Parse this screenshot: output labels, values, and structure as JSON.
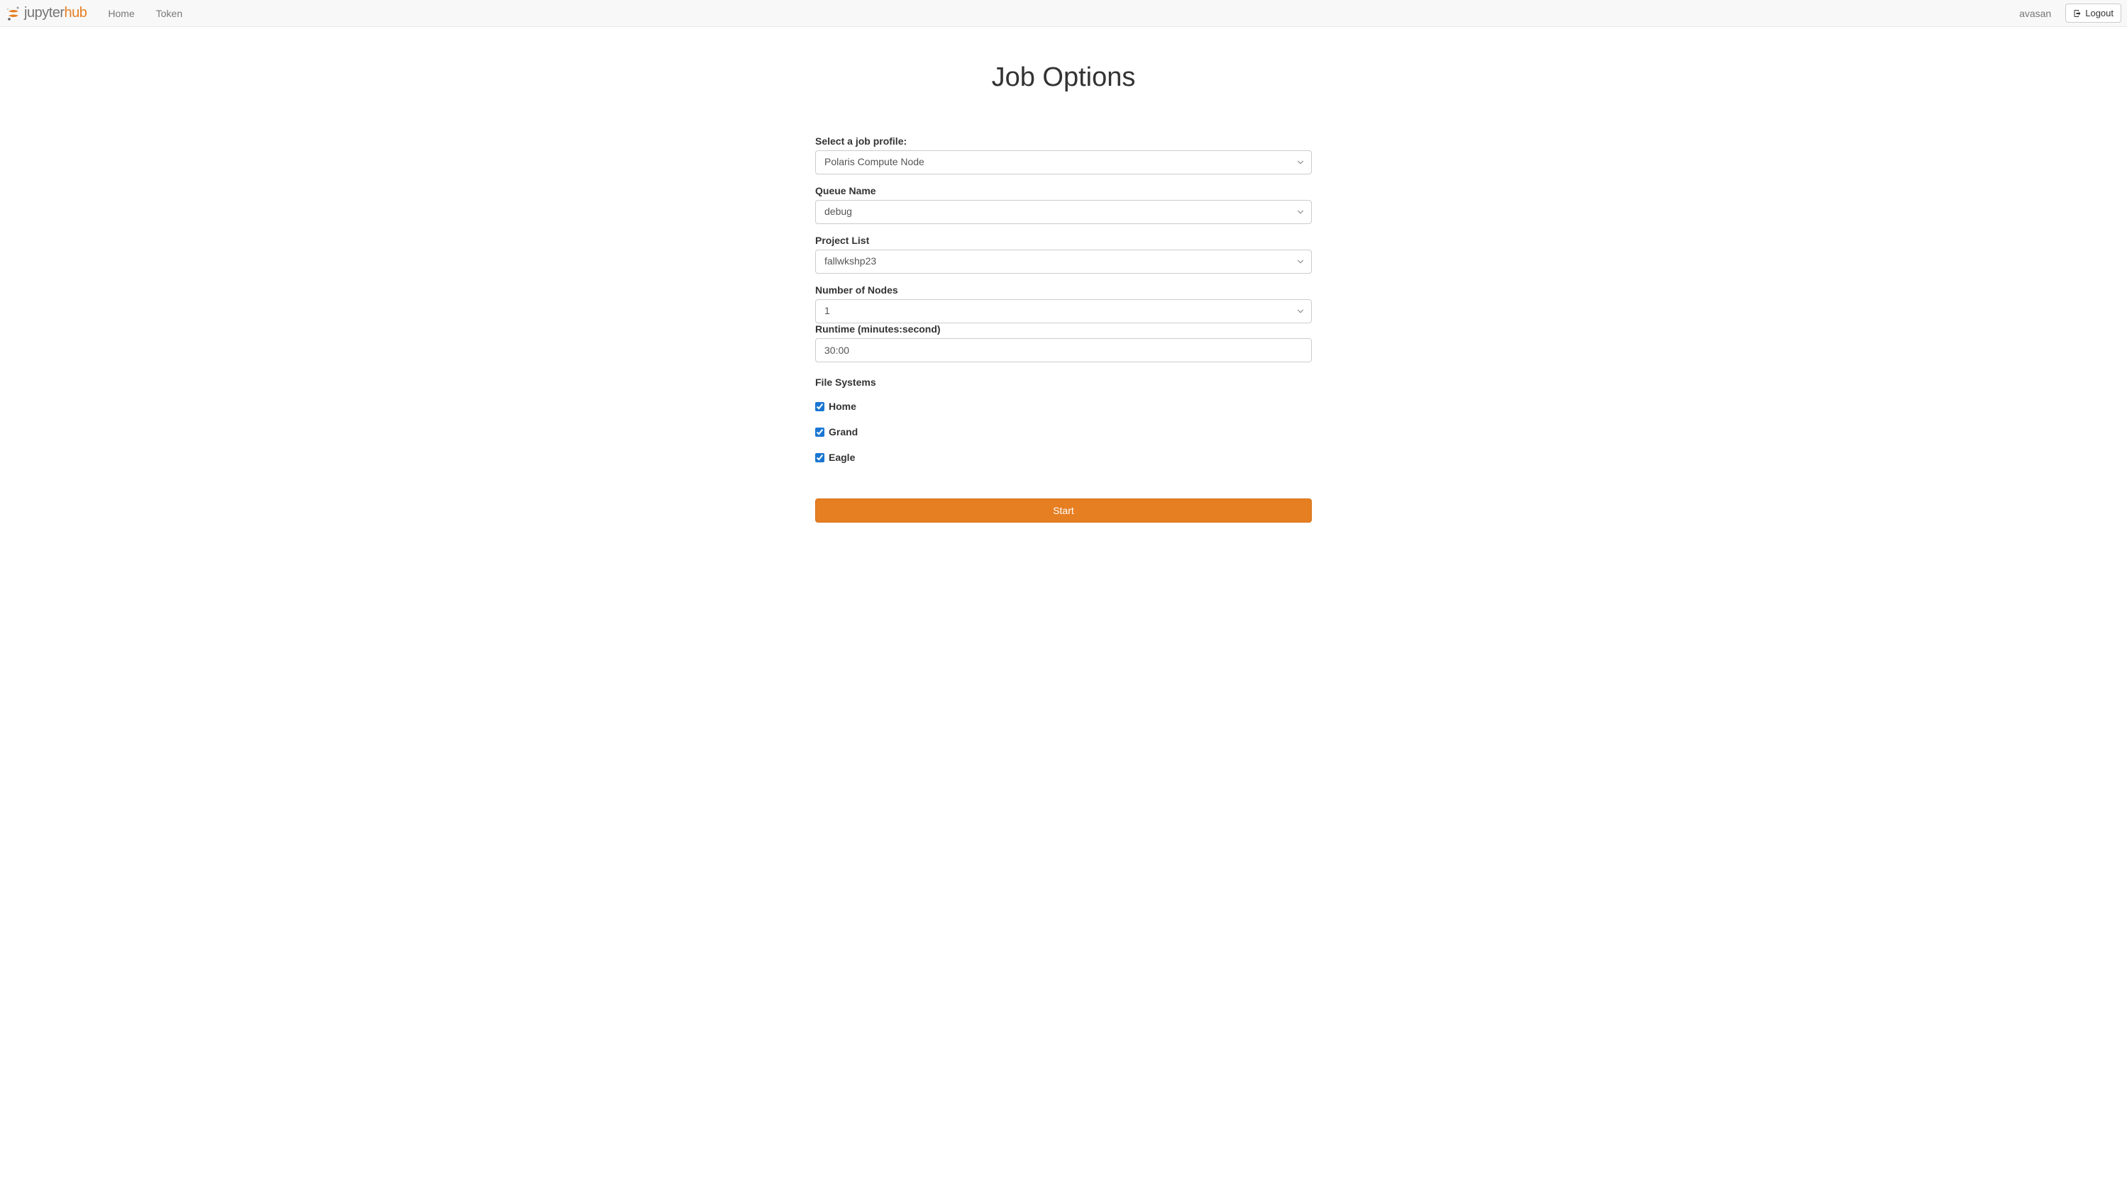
{
  "navbar": {
    "logo_jupyter": "jupyter",
    "logo_hub": "hub",
    "home_label": "Home",
    "token_label": "Token",
    "username": "avasan",
    "logout_label": "Logout"
  },
  "page": {
    "title": "Job Options"
  },
  "form": {
    "profile": {
      "label": "Select a job profile:",
      "value": "Polaris Compute Node"
    },
    "queue": {
      "label": "Queue Name",
      "value": "debug"
    },
    "project": {
      "label": "Project List",
      "value": "fallwkshp23"
    },
    "nodes": {
      "label": "Number of Nodes",
      "value": "1"
    },
    "runtime": {
      "label": "Runtime (minutes:second)",
      "value": "30:00"
    },
    "filesystems": {
      "label": "File Systems",
      "items": [
        {
          "label": "Home",
          "checked": true
        },
        {
          "label": "Grand",
          "checked": true
        },
        {
          "label": "Eagle",
          "checked": true
        }
      ]
    },
    "submit_label": "Start"
  }
}
